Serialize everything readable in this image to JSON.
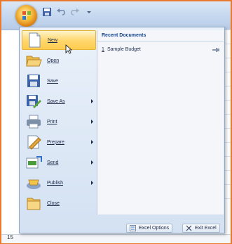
{
  "menu": {
    "items": [
      {
        "label": "New",
        "icon": "new-document-icon",
        "has_arrow": false,
        "selected": true
      },
      {
        "label": "Open",
        "icon": "open-folder-icon",
        "has_arrow": false
      },
      {
        "label": "Save",
        "icon": "save-disk-icon",
        "has_arrow": false
      },
      {
        "label": "Save As",
        "icon": "save-as-icon",
        "has_arrow": true
      },
      {
        "label": "Print",
        "icon": "printer-icon",
        "has_arrow": true
      },
      {
        "label": "Prepare",
        "icon": "prepare-icon",
        "has_arrow": true
      },
      {
        "label": "Send",
        "icon": "send-icon",
        "has_arrow": true
      },
      {
        "label": "Publish",
        "icon": "publish-icon",
        "has_arrow": true
      },
      {
        "label": "Close",
        "icon": "close-folder-icon",
        "has_arrow": false
      }
    ]
  },
  "recent": {
    "title": "Recent Documents",
    "items": [
      {
        "number": "1",
        "name": "Sample Budget"
      }
    ]
  },
  "footer": {
    "options_label": "Excel Options",
    "exit_label": "Exit Excel"
  },
  "sheet": {
    "row_number": "15"
  },
  "colors": {
    "accent_border": "#e8792d",
    "selected_highlight": "#ffd66b",
    "menu_text": "#1b2a49",
    "title_text": "#15428b"
  }
}
